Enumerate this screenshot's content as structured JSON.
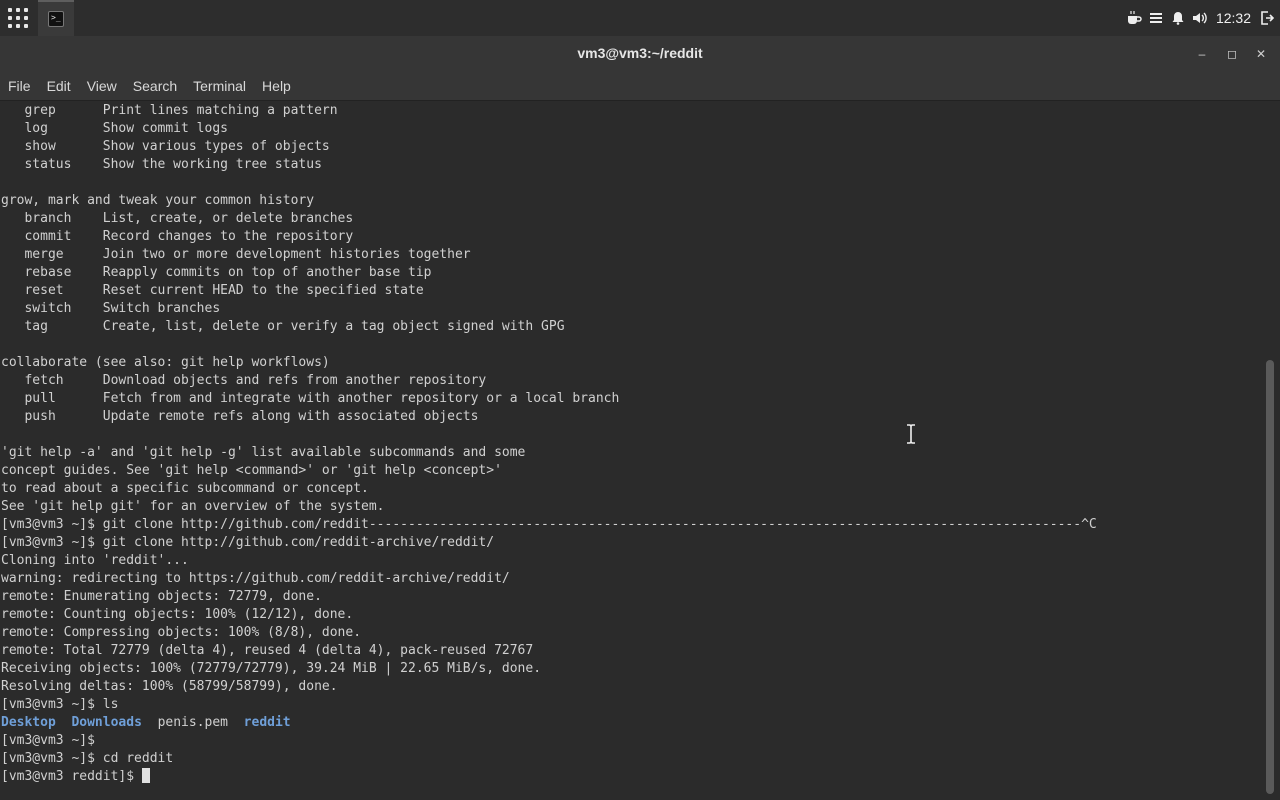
{
  "panel": {
    "clock": "12:32",
    "icons": [
      "apps-grid-icon",
      "terminal-task-icon",
      "coffee-icon",
      "list-icon",
      "bell-icon",
      "volume-icon",
      "logout-icon"
    ]
  },
  "window": {
    "title": "vm3@vm3:~/reddit",
    "controls": {
      "minimize": "–",
      "maximize": "◻",
      "close": "✕"
    }
  },
  "menu": [
    "File",
    "Edit",
    "View",
    "Search",
    "Terminal",
    "Help"
  ],
  "terminal": {
    "lines": [
      "   grep      Print lines matching a pattern",
      "   log       Show commit logs",
      "   show      Show various types of objects",
      "   status    Show the working tree status",
      "",
      "grow, mark and tweak your common history",
      "   branch    List, create, or delete branches",
      "   commit    Record changes to the repository",
      "   merge     Join two or more development histories together",
      "   rebase    Reapply commits on top of another base tip",
      "   reset     Reset current HEAD to the specified state",
      "   switch    Switch branches",
      "   tag       Create, list, delete or verify a tag object signed with GPG",
      "",
      "collaborate (see also: git help workflows)",
      "   fetch     Download objects and refs from another repository",
      "   pull      Fetch from and integrate with another repository or a local branch",
      "   push      Update remote refs along with associated objects",
      "",
      "'git help -a' and 'git help -g' list available subcommands and some",
      "concept guides. See 'git help <command>' or 'git help <concept>'",
      "to read about a specific subcommand or concept.",
      "See 'git help git' for an overview of the system.",
      "[vm3@vm3 ~]$ git clone http://github.com/reddit-------------------------------------------------------------------------------------------^C",
      "[vm3@vm3 ~]$ git clone http://github.com/reddit-archive/reddit/",
      "Cloning into 'reddit'...",
      "warning: redirecting to https://github.com/reddit-archive/reddit/",
      "remote: Enumerating objects: 72779, done.",
      "remote: Counting objects: 100% (12/12), done.",
      "remote: Compressing objects: 100% (8/8), done.",
      "remote: Total 72779 (delta 4), reused 4 (delta 4), pack-reused 72767",
      "Receiving objects: 100% (72779/72779), 39.24 MiB | 22.65 MiB/s, done.",
      "Resolving deltas: 100% (58799/58799), done.",
      "[vm3@vm3 ~]$ ls"
    ],
    "ls_output": [
      {
        "name": "Desktop",
        "type": "dir"
      },
      {
        "name": "Downloads",
        "type": "dir"
      },
      {
        "name": "penis.pem",
        "type": "file"
      },
      {
        "name": "reddit",
        "type": "dir"
      }
    ],
    "after_lines": [
      "[vm3@vm3 ~]$",
      "[vm3@vm3 ~]$ cd reddit"
    ],
    "prompt": "[vm3@vm3 reddit]$ "
  },
  "colors": {
    "directory": "#6f9fd8",
    "text": "#d0d0d0",
    "background": "#2b2b2b"
  }
}
